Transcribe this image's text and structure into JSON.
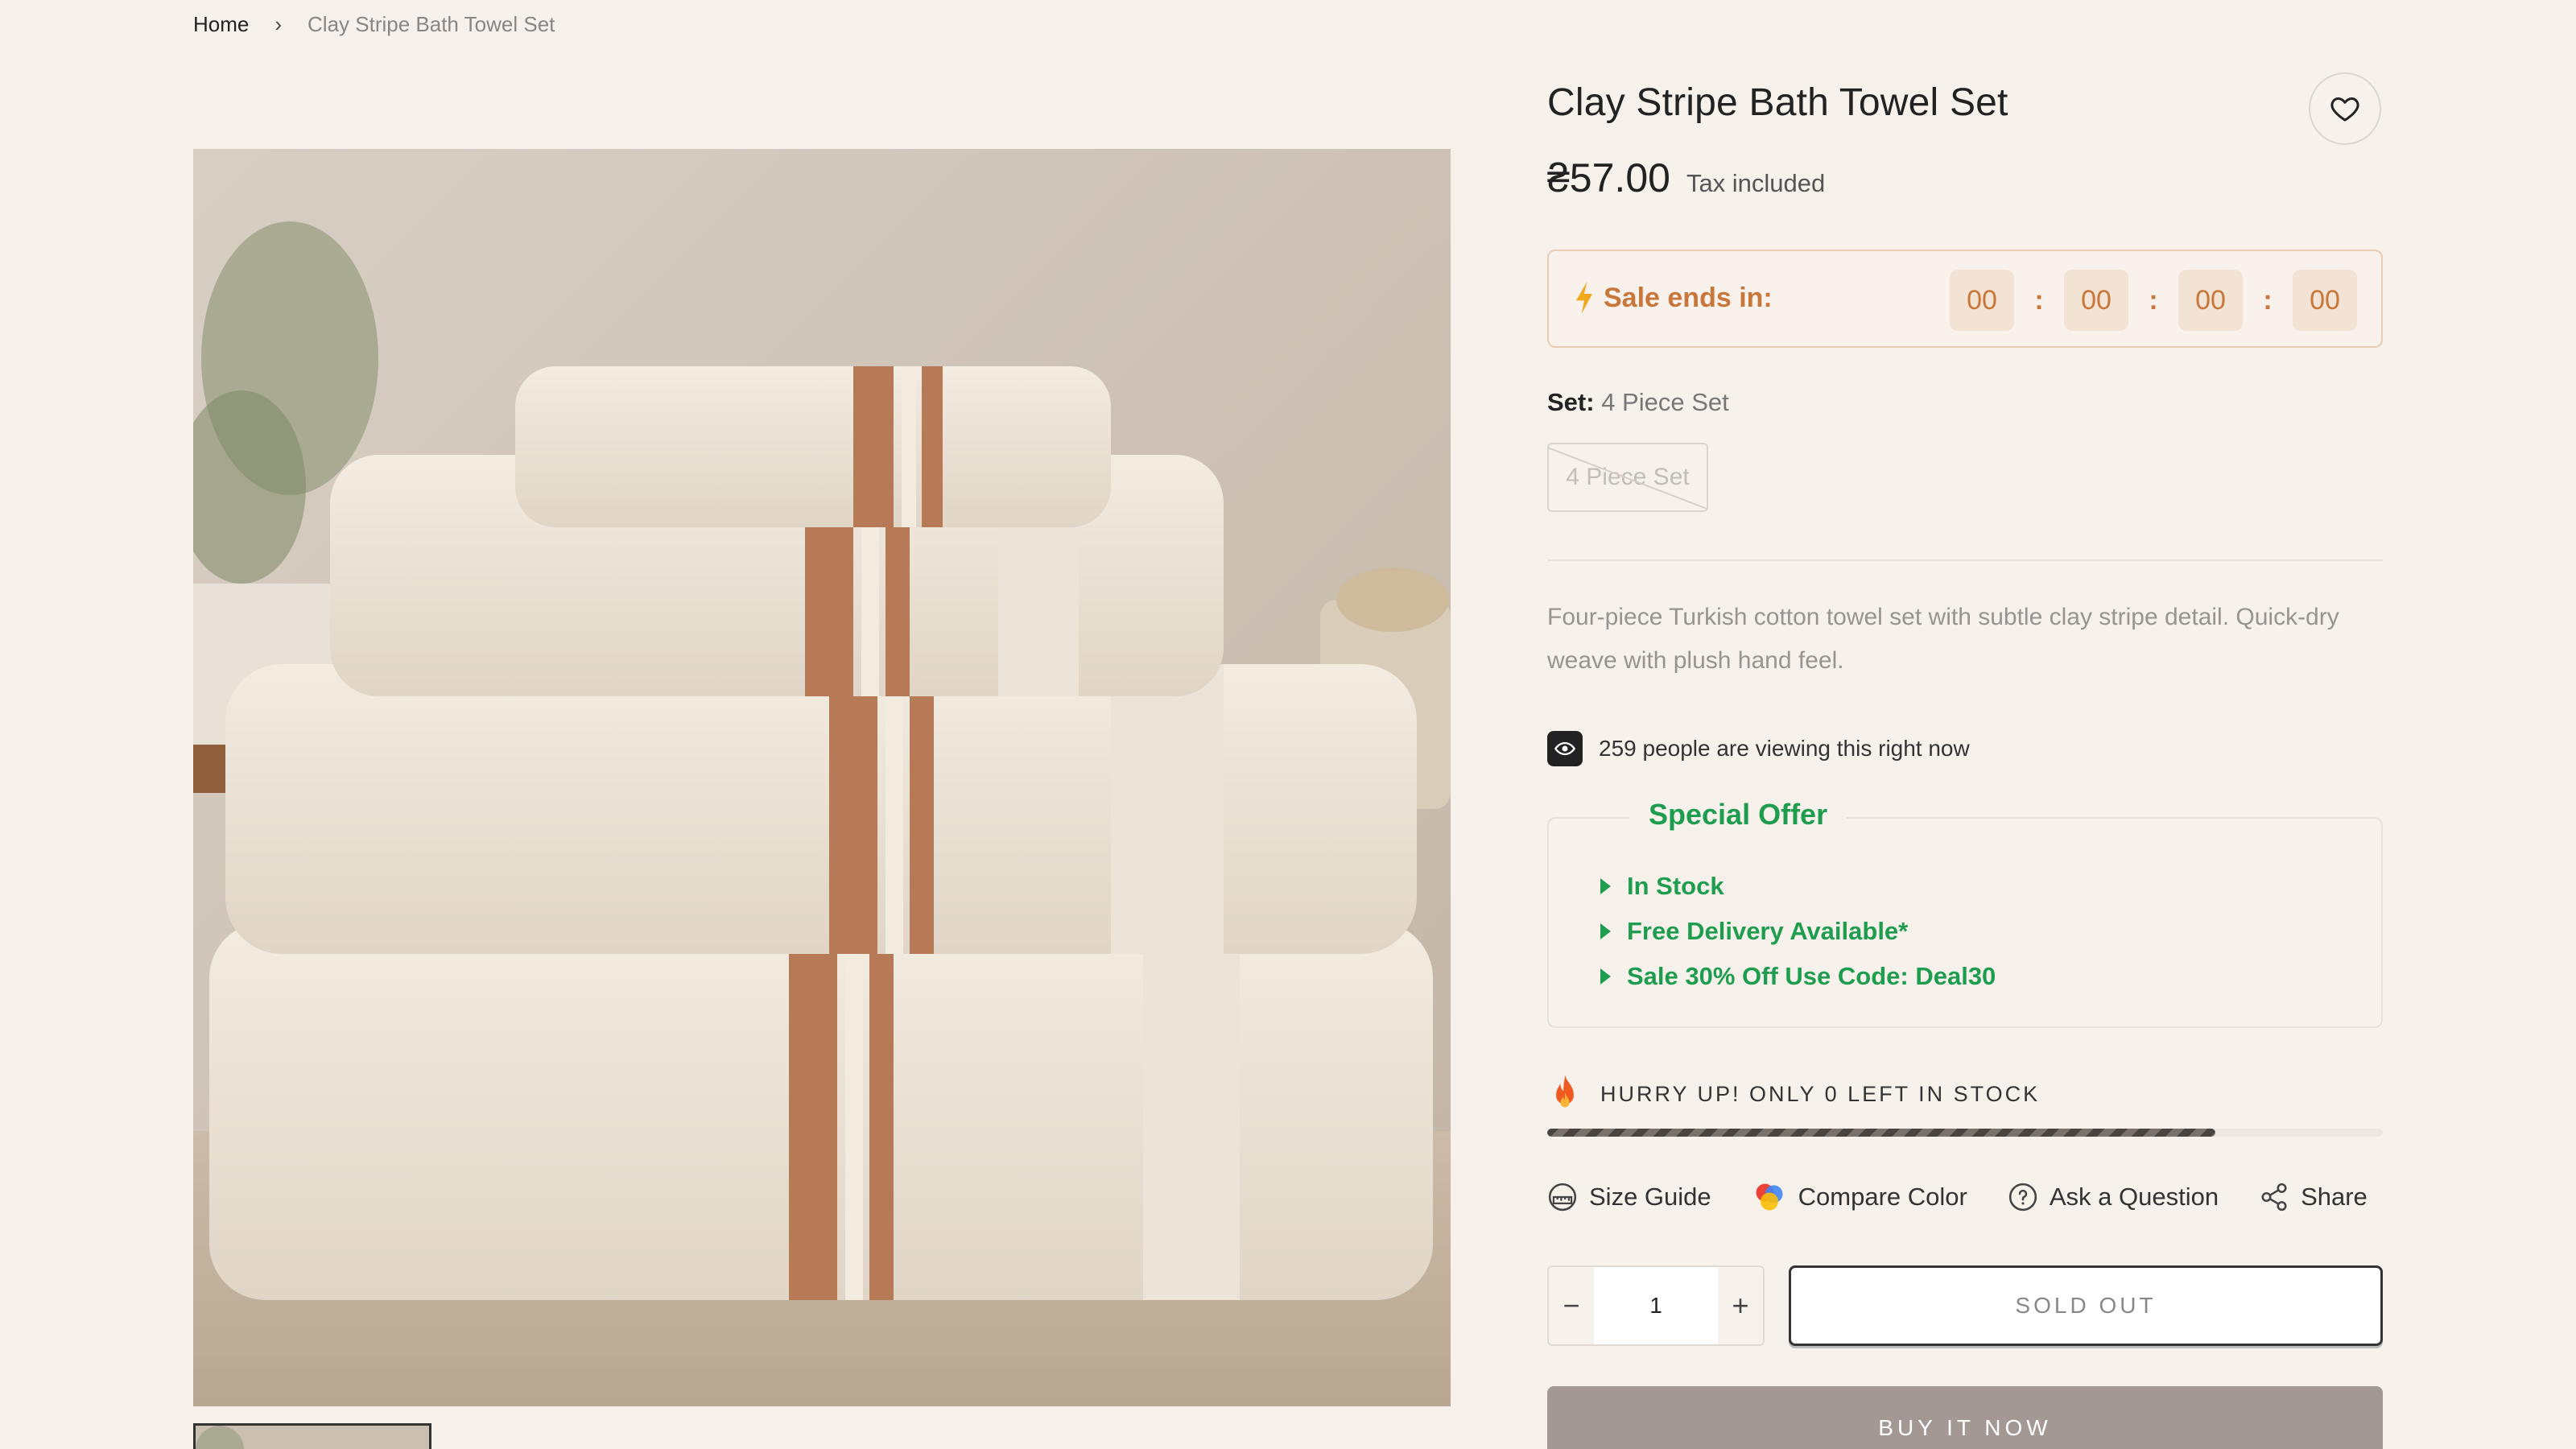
{
  "breadcrumb": {
    "home": "Home",
    "separator": "›",
    "current": "Clay Stripe Bath Towel Set"
  },
  "product": {
    "title": "Clay Stripe Bath Towel Set",
    "price": "₴57.00",
    "tax_note": "Tax included",
    "image_alt": "Stack of four cream towels with clay stripes"
  },
  "countdown": {
    "label": "Sale ends in:",
    "days": "00",
    "hours": "00",
    "minutes": "00",
    "seconds": "00",
    "separator": ":"
  },
  "variant": {
    "label": "Set:",
    "selected": "4 Piece Set",
    "options": [
      "4 Piece Set"
    ]
  },
  "description": "Four-piece Turkish cotton towel set with subtle clay stripe detail. Quick-dry weave with plush hand feel.",
  "viewing": "259 people are viewing this right now",
  "offer": {
    "title": "Special Offer",
    "items": [
      "In Stock",
      "Free Delivery Available*",
      "Sale 30% Off Use Code: Deal30"
    ]
  },
  "stock": {
    "message": "HURRY UP! ONLY 0 LEFT IN STOCK",
    "level": 0.8
  },
  "links": {
    "size_guide": "Size Guide",
    "compare_color": "Compare Color",
    "ask_question": "Ask a Question",
    "share": "Share"
  },
  "quantity": {
    "value": "1",
    "minus": "−",
    "plus": "+"
  },
  "buttons": {
    "sold_out": "SOLD OUT",
    "buy_now": "BUY IT NOW"
  },
  "colors": {
    "accent": "#c8763a",
    "offer_green": "#1f9d4f",
    "background": "#f7f1ec",
    "buy_now_bg": "#a39894"
  },
  "icons": {
    "wishlist": "heart-icon",
    "lightning": "lightning-icon",
    "eye": "eye-icon",
    "fire": "fire-icon",
    "size_guide": "ruler-icon",
    "compare_color": "color-dots-icon",
    "ask": "question-circle-icon",
    "share": "share-icon"
  }
}
